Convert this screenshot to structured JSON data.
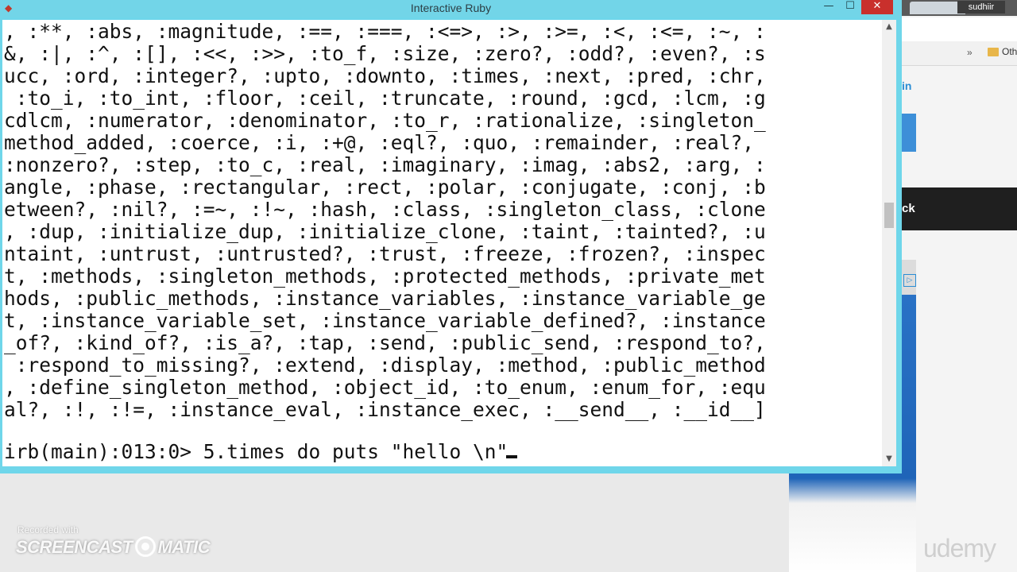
{
  "window": {
    "title": "Interactive Ruby",
    "minimize_glyph": "—",
    "maximize_glyph": "☐",
    "close_glyph": "✕"
  },
  "console": {
    "output": ", :**, :abs, :magnitude, :==, :===, :<=>, :>, :>=, :<, :<=, :~, :\n&, :|, :^, :[], :<<, :>>, :to_f, :size, :zero?, :odd?, :even?, :s\nucc, :ord, :integer?, :upto, :downto, :times, :next, :pred, :chr,\n :to_i, :to_int, :floor, :ceil, :truncate, :round, :gcd, :lcm, :g\ncdlcm, :numerator, :denominator, :to_r, :rationalize, :singleton_\nmethod_added, :coerce, :i, :+@, :eql?, :quo, :remainder, :real?,\n:nonzero?, :step, :to_c, :real, :imaginary, :imag, :abs2, :arg, :\nangle, :phase, :rectangular, :rect, :polar, :conjugate, :conj, :b\netween?, :nil?, :=~, :!~, :hash, :class, :singleton_class, :clone\n, :dup, :initialize_dup, :initialize_clone, :taint, :tainted?, :u\nntaint, :untrust, :untrusted?, :trust, :freeze, :frozen?, :inspec\nt, :methods, :singleton_methods, :protected_methods, :private_met\nhods, :public_methods, :instance_variables, :instance_variable_ge\nt, :instance_variable_set, :instance_variable_defined?, :instance\n_of?, :kind_of?, :is_a?, :tap, :send, :public_send, :respond_to?,\n :respond_to_missing?, :extend, :display, :method, :public_method\n, :define_singleton_method, :object_id, :to_enum, :enum_for, :equ\nal?, :!, :!=, :instance_eval, :instance_exec, :__send__, :__id__]",
    "prompt": "irb(main):013:0> 5.times do puts \"hello \\n\""
  },
  "background_browser": {
    "username": "sudhiir",
    "bookmarks_overflow": "»",
    "bookmarks_folder": "Oth",
    "link_text": "in",
    "banner_text": "ck",
    "ad_choices_glyph": "▷"
  },
  "watermark": {
    "recorded_with": "Recorded with",
    "brand_left": "SCREENCAST",
    "brand_right": "MATIC",
    "udemy": "udemy"
  },
  "colors": {
    "title_bar": "#72d5e8",
    "close_button": "#c9302c",
    "console_bg": "#ffffff",
    "console_fg": "#111111"
  }
}
